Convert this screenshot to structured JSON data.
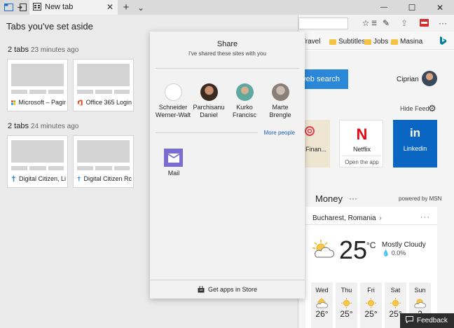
{
  "tabbar": {
    "tab_title": "New tab",
    "close_tab_glyph": "✕",
    "new_tab_glyph": "+",
    "tab_list_glyph": "⌄",
    "minimize_glyph": "—",
    "maximize_glyph": "☐",
    "close_window_glyph": "✕"
  },
  "toolbar": {
    "favorites_glyph": "☆",
    "reading_glyph": "☰",
    "notes_glyph": "✎",
    "share_glyph": "⇪",
    "more_glyph": "···"
  },
  "favorites_bar": {
    "items": [
      "Travel",
      "Subtitles",
      "Jobs",
      "Masina"
    ]
  },
  "new_tab_page": {
    "search_button": "web search",
    "user_name": "Ciprian",
    "hide_feed": "Hide Feed",
    "tiles": [
      {
        "label": "Finan..."
      },
      {
        "label": "Netflix",
        "sub": "Open the app",
        "logo": "N"
      },
      {
        "label": "Linkedin",
        "logo": "in"
      }
    ],
    "money_header": "Money",
    "money_more": "···",
    "powered_by": "powered by MSN",
    "weather": {
      "location": "Bucharest, Romania",
      "location_chevron": "›",
      "more": "···",
      "temperature": "25",
      "unit": "°C",
      "condition": "Mostly Cloudy",
      "precip": "0.0%",
      "days": [
        {
          "name": "Wed",
          "temp": "26°"
        },
        {
          "name": "Thu",
          "temp": "25°"
        },
        {
          "name": "Fri",
          "temp": "25°"
        },
        {
          "name": "Sat",
          "temp": "25°"
        },
        {
          "name": "Sun",
          "temp": "2"
        }
      ]
    },
    "feedback": "Feedback"
  },
  "tabs_aside": {
    "title": "Tabs you've set aside",
    "groups": [
      {
        "count": "2 tabs",
        "ago": "23 minutes ago",
        "cards": [
          {
            "title": "Microsoft – Pagir"
          },
          {
            "title": "Office 365 Login"
          }
        ]
      },
      {
        "count": "2 tabs",
        "ago": "24 minutes ago",
        "cards": [
          {
            "title": "Digital Citizen, Li"
          },
          {
            "title": "Digital Citizen Rc"
          }
        ]
      }
    ]
  },
  "share_panel": {
    "title": "Share",
    "subtitle": "I've shared these sites with you",
    "people": [
      {
        "line1": "Schneider",
        "line2": "Werner-Walt",
        "color": "#ffffff"
      },
      {
        "line1": "Parchisanu",
        "line2": "Daniel",
        "color": "#5a4030"
      },
      {
        "line1": "Kurko",
        "line2": "Francisc",
        "color": "#6aa8a0"
      },
      {
        "line1": "Marte",
        "line2": "Brengle",
        "color": "#a89a90"
      }
    ],
    "more_people": "More people",
    "apps": [
      {
        "label": "Mail"
      }
    ],
    "store_link": "Get apps in Store"
  }
}
